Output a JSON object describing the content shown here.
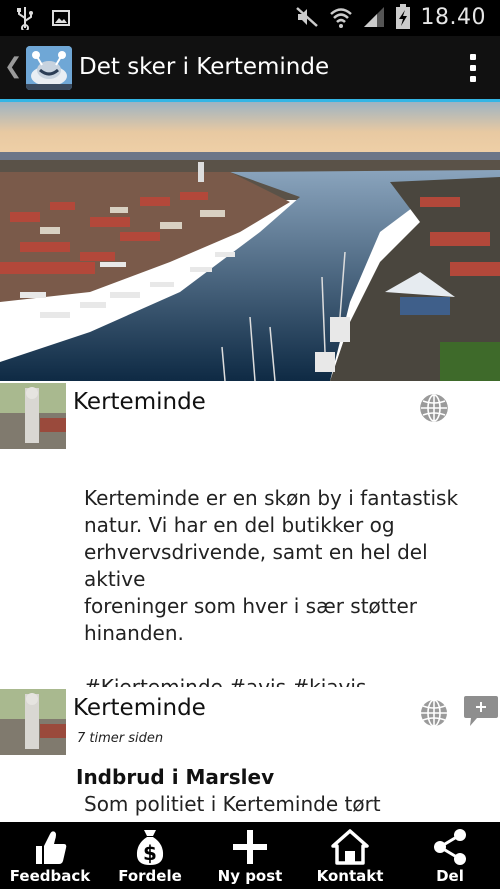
{
  "status_bar": {
    "time": "18.40",
    "icons": [
      "usb-icon",
      "image-notification-icon",
      "mute-icon",
      "wifi-icon",
      "signal-icon",
      "battery-charging-icon"
    ]
  },
  "action_bar": {
    "back_icon": "chevron-left-icon",
    "title": "Det sker i Kerteminde",
    "overflow_icon": "overflow-menu-icon"
  },
  "hero": {
    "image": "aerial-harbor-photo"
  },
  "posts": [
    {
      "author": "Kerteminde",
      "body_lines": [
        "Kerteminde er en skøn by i fantastisk",
        "natur. Vi har en del butikker og",
        "erhvervsdrivende, samt en hel del aktive",
        "foreninger som hver i sær støtter",
        "hinanden."
      ],
      "tags": "#Kjerteminde #avis #kjavis"
    },
    {
      "author": "Kerteminde",
      "time_ago": "7 timer siden",
      "headline": "Indbrud i Marslev",
      "body_line": "Som politiet i Kerteminde tørt",
      "comment_icon": "comment-plus-icon"
    }
  ],
  "bottom_nav": [
    {
      "label": "Feedback",
      "icon": "thumbs-up-icon"
    },
    {
      "label": "Fordele",
      "icon": "money-bag-icon"
    },
    {
      "label": "Ny post",
      "icon": "plus-icon"
    },
    {
      "label": "Kontakt",
      "icon": "home-icon"
    },
    {
      "label": "Del",
      "icon": "share-icon"
    }
  ],
  "colors": {
    "status_bar": "#000000",
    "action_bar": "#111111",
    "accent": "#33b5e5",
    "bottom_nav": "#000000"
  }
}
